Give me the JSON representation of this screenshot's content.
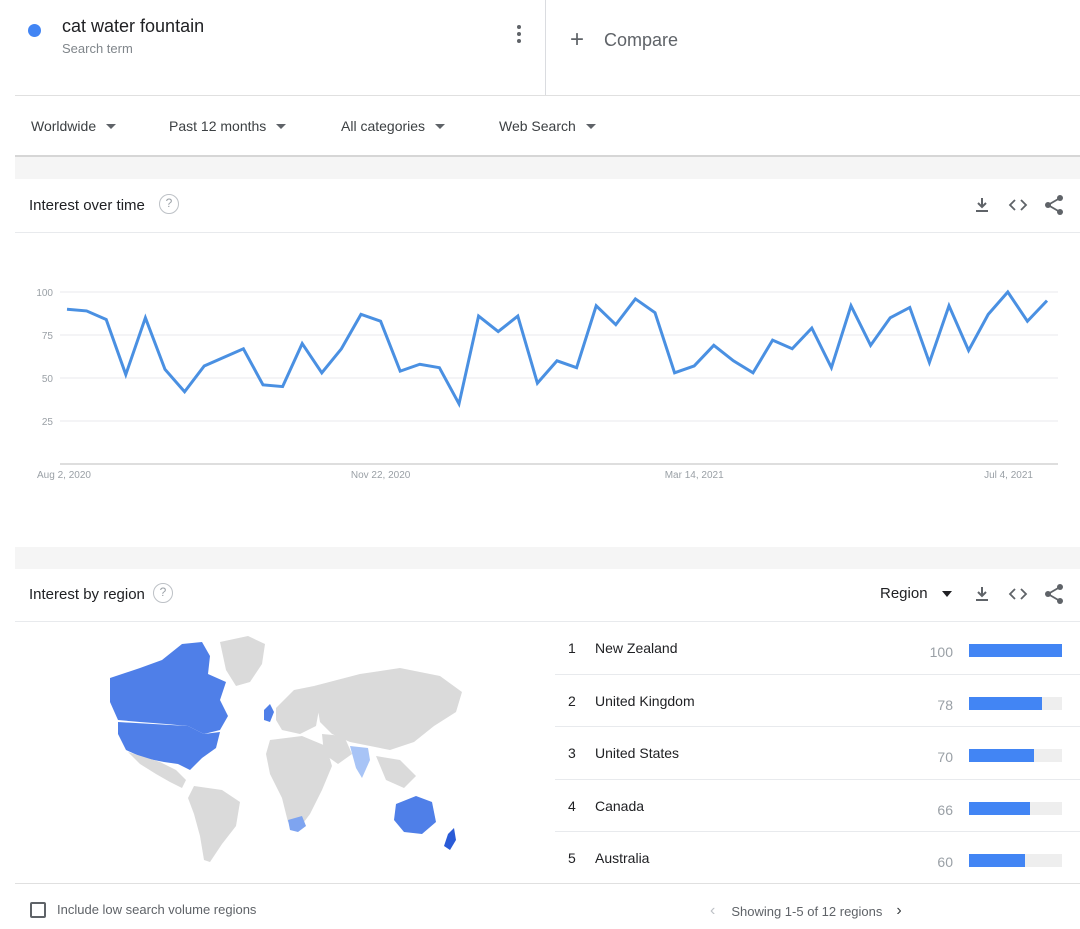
{
  "search_term": {
    "title": "cat water fountain",
    "subtitle": "Search term",
    "color": "#4285f4"
  },
  "compare": {
    "plus": "+",
    "label": "Compare"
  },
  "filters": {
    "location": "Worldwide",
    "time_range": "Past 12 months",
    "category": "All categories",
    "search_type": "Web Search"
  },
  "interest_over_time": {
    "title": "Interest over time",
    "help": "?"
  },
  "chart_data": {
    "type": "line",
    "series": [
      {
        "values": [
          90,
          89,
          84,
          52,
          85,
          55,
          42,
          57,
          62,
          67,
          46,
          45,
          70,
          53,
          67,
          87,
          83,
          54,
          58,
          56,
          35,
          86,
          77,
          86,
          47,
          60,
          56,
          92,
          81,
          96,
          88,
          53,
          57,
          69,
          60,
          53,
          72,
          67,
          79,
          56,
          92,
          69,
          85,
          91,
          59,
          92,
          66,
          87,
          100,
          83,
          95
        ]
      }
    ],
    "ylim": [
      0,
      100
    ],
    "yticks": [
      "25",
      "50",
      "75",
      "100"
    ],
    "xtick_labels": [
      {
        "index": 0,
        "label": "Aug 2, 2020"
      },
      {
        "index": 16,
        "label": "Nov 22, 2020"
      },
      {
        "index": 32,
        "label": "Mar 14, 2021"
      },
      {
        "index": 48,
        "label": "Jul 4, 2021"
      }
    ],
    "color": "#4a90e2",
    "grid": true
  },
  "interest_by_region": {
    "title": "Interest by region",
    "help": "?",
    "resolution": "Region",
    "regions": [
      {
        "rank": "1",
        "name": "New Zealand",
        "value": 100
      },
      {
        "rank": "2",
        "name": "United Kingdom",
        "value": 78
      },
      {
        "rank": "3",
        "name": "United States",
        "value": 70
      },
      {
        "rank": "4",
        "name": "Canada",
        "value": 66
      },
      {
        "rank": "5",
        "name": "Australia",
        "value": 60
      }
    ],
    "bar_color": "#4285f4"
  },
  "footer": {
    "checkbox_label": "Include low search volume regions",
    "pager_prev": "‹",
    "pager_text": "Showing 1-5 of 12 regions",
    "pager_next": "›"
  }
}
